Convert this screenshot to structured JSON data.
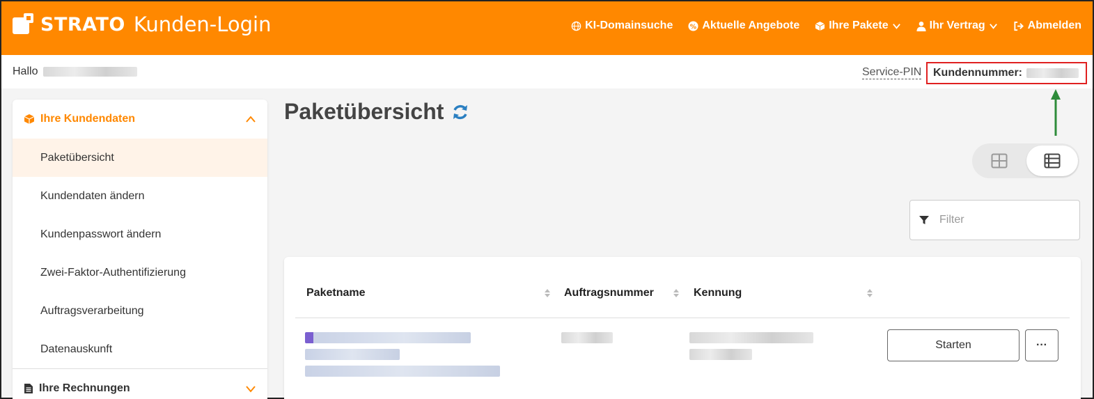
{
  "header": {
    "brand": "STRATO",
    "subtitle": "Kunden-Login",
    "nav": [
      {
        "label": "KI-Domainsuche",
        "icon": "globe-icon"
      },
      {
        "label": "Aktuelle Angebote",
        "icon": "percent-badge-icon"
      },
      {
        "label": "Ihre Pakete",
        "icon": "package-icon",
        "dropdown": true
      },
      {
        "label": "Ihr Vertrag",
        "icon": "user-icon",
        "dropdown": true
      },
      {
        "label": "Abmelden",
        "icon": "logout-icon"
      }
    ]
  },
  "subbar": {
    "greeting": "Hallo",
    "service_pin": "Service-PIN",
    "customer_number_label": "Kundennummer:"
  },
  "sidebar": {
    "section1": {
      "label": "Ihre Kundendaten",
      "icon": "package-icon",
      "expanded": true
    },
    "items": [
      {
        "label": "Paketübersicht",
        "active": true
      },
      {
        "label": "Kundendaten ändern"
      },
      {
        "label": "Kundenpasswort ändern"
      },
      {
        "label": "Zwei-Faktor-Authentifizierung"
      },
      {
        "label": "Auftragsverarbeitung"
      },
      {
        "label": "Datenauskunft"
      }
    ],
    "section2": {
      "label": "Ihre Rechnungen",
      "icon": "document-icon",
      "expanded": false
    }
  },
  "main": {
    "title": "Paketübersicht",
    "view_toggle": {
      "options": [
        "grid-view-icon",
        "list-view-icon"
      ],
      "selected": "list-view-icon"
    },
    "filter_placeholder": "Filter",
    "table": {
      "columns": [
        "Paketname",
        "Auftragsnummer",
        "Kennung"
      ],
      "row_actions": {
        "start": "Starten",
        "more": "···"
      }
    }
  },
  "colors": {
    "brand_orange": "#ff8800",
    "highlight_red": "#e02020",
    "arrow_green": "#2e8b3a",
    "refresh_blue": "#2a7fc1"
  }
}
